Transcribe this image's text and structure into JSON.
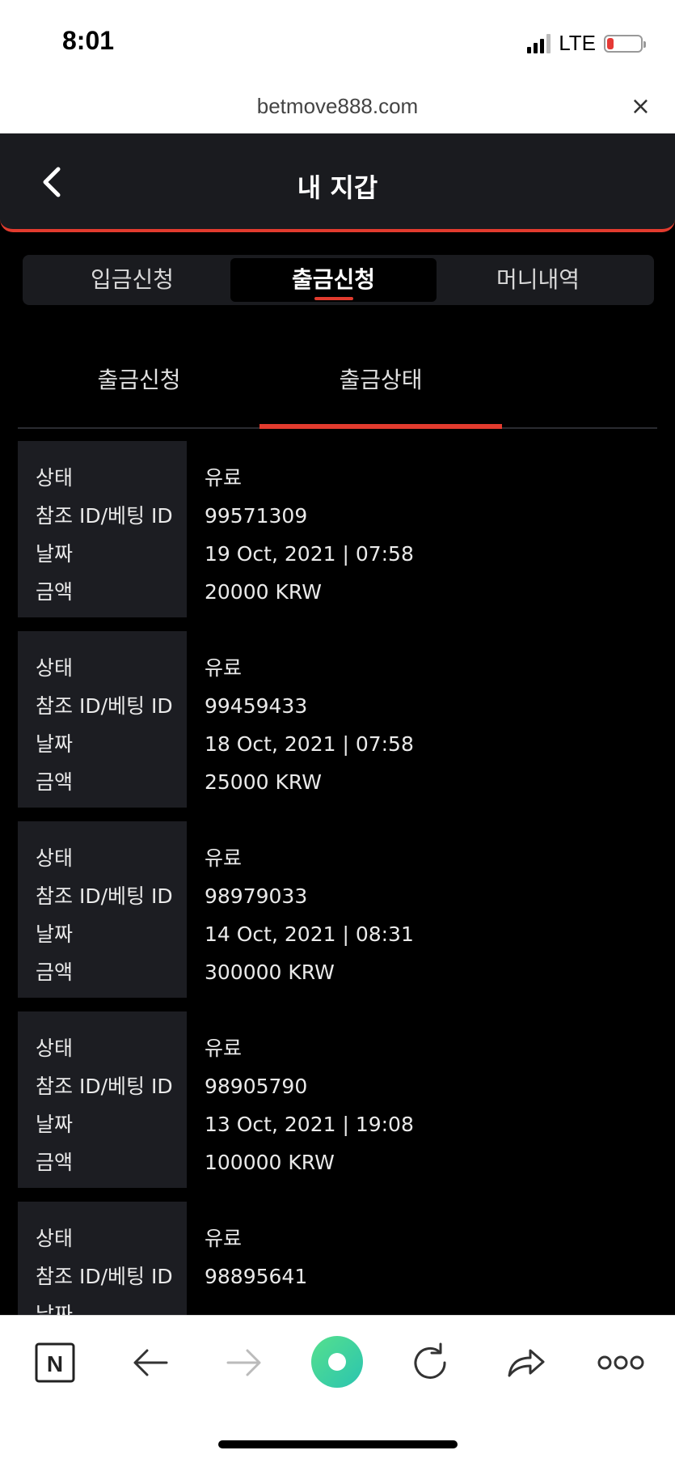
{
  "status": {
    "time": "8:01",
    "network": "LTE",
    "battery_level": 0.2,
    "battery_color": "#e53935"
  },
  "browser": {
    "url": "betmove888.com",
    "close_label": "×"
  },
  "header": {
    "title": "내 지갑"
  },
  "tabs": [
    {
      "label": "입금신청",
      "active": false
    },
    {
      "label": "출금신청",
      "active": true
    },
    {
      "label": "머니내역",
      "active": false
    }
  ],
  "subtabs": [
    {
      "label": "출금신청",
      "active": false
    },
    {
      "label": "출금상태",
      "active": true
    }
  ],
  "field_labels": {
    "status": "상태",
    "ref_id": "참조 ID/베팅 ID",
    "date": "날짜",
    "amount": "금액"
  },
  "records": [
    {
      "status": "유료",
      "ref_id": "99571309",
      "date": "19 Oct, 2021 | 07:58",
      "amount": "20000 KRW"
    },
    {
      "status": "유료",
      "ref_id": "99459433",
      "date": "18 Oct, 2021 | 07:58",
      "amount": "25000 KRW"
    },
    {
      "status": "유료",
      "ref_id": "98979033",
      "date": "14 Oct, 2021 | 08:31",
      "amount": "300000 KRW"
    },
    {
      "status": "유료",
      "ref_id": "98905790",
      "date": "13 Oct, 2021 | 19:08",
      "amount": "100000 KRW"
    },
    {
      "status": "유료",
      "ref_id": "98895641",
      "date": "",
      "amount": ""
    }
  ],
  "bottom_bar": {
    "icons": [
      "naver-icon",
      "back-arrow-icon",
      "forward-arrow-icon",
      "home-dot-icon",
      "refresh-icon",
      "share-icon",
      "more-icon"
    ],
    "home_gradient": [
      "#3ddc97",
      "#2bc4b0"
    ],
    "naver_label": "N"
  },
  "accent_color": "#e23b2e"
}
